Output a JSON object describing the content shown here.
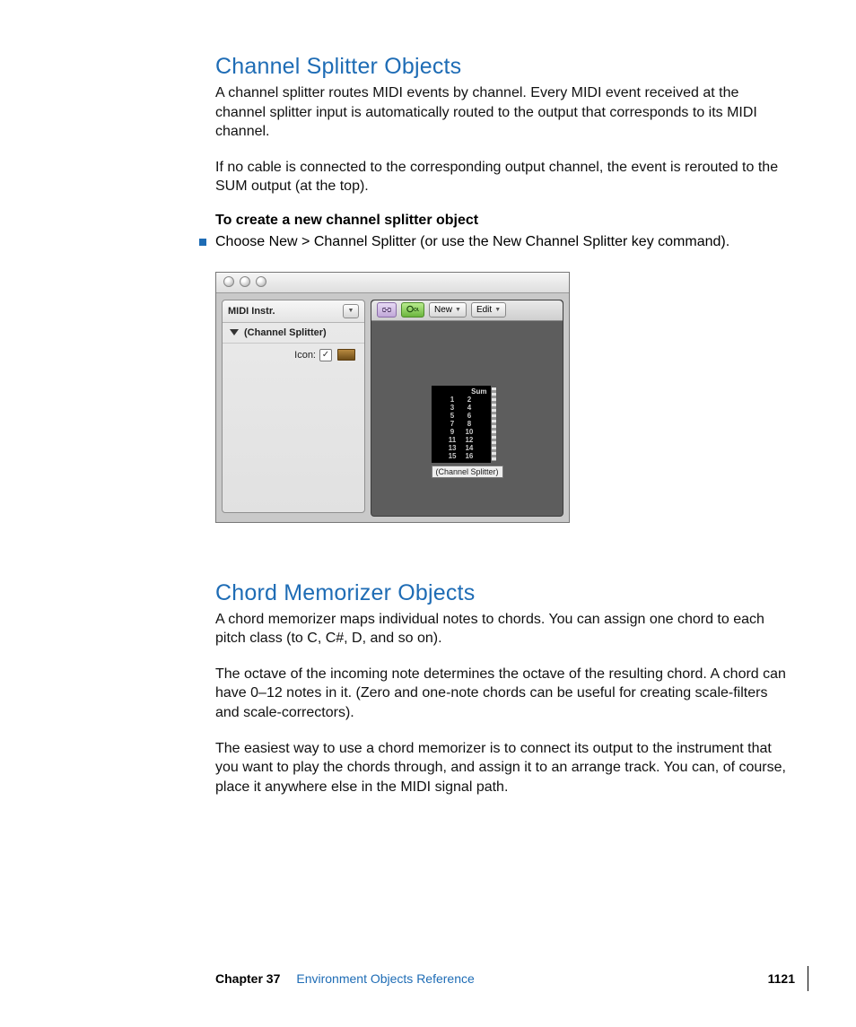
{
  "section1": {
    "heading": "Channel Splitter Objects",
    "p1": "A channel splitter routes MIDI events by channel. Every MIDI event received at the channel splitter input is automatically routed to the output that corresponds to its MIDI channel.",
    "p2": "If no cable is connected to the corresponding output channel, the event is rerouted to the SUM output (at the top).",
    "subhead": "To create a new channel splitter object",
    "bullet": "Choose New > Channel Splitter (or use the New Channel Splitter key command)."
  },
  "screenshot": {
    "inspector": {
      "title": "MIDI Instr.",
      "row_label": "(Channel Splitter)",
      "icon_label": "Icon:"
    },
    "toolbar": {
      "new": "New",
      "edit": "Edit"
    },
    "object": {
      "sum": "Sum",
      "odd": [
        "1",
        "3",
        "5",
        "7",
        "9",
        "11",
        "13",
        "15"
      ],
      "even": [
        "2",
        "4",
        "6",
        "8",
        "10",
        "12",
        "14",
        "16"
      ],
      "caption": "(Channel Splitter)"
    }
  },
  "section2": {
    "heading": "Chord Memorizer Objects",
    "p1": "A chord memorizer maps individual notes to chords. You can assign one chord to each pitch class (to C, C#, D, and so on).",
    "p2": "The octave of the incoming note determines the octave of the resulting chord. A chord can have 0–12 notes in it. (Zero and one-note chords can be useful for creating scale-filters and scale-correctors).",
    "p3": "The easiest way to use a chord memorizer is to connect its output to the instrument that you want to play the chords through, and assign it to an arrange track. You can, of course, place it anywhere else in the MIDI signal path."
  },
  "footer": {
    "chapter": "Chapter 37",
    "title": "Environment Objects Reference",
    "page": "1121"
  }
}
